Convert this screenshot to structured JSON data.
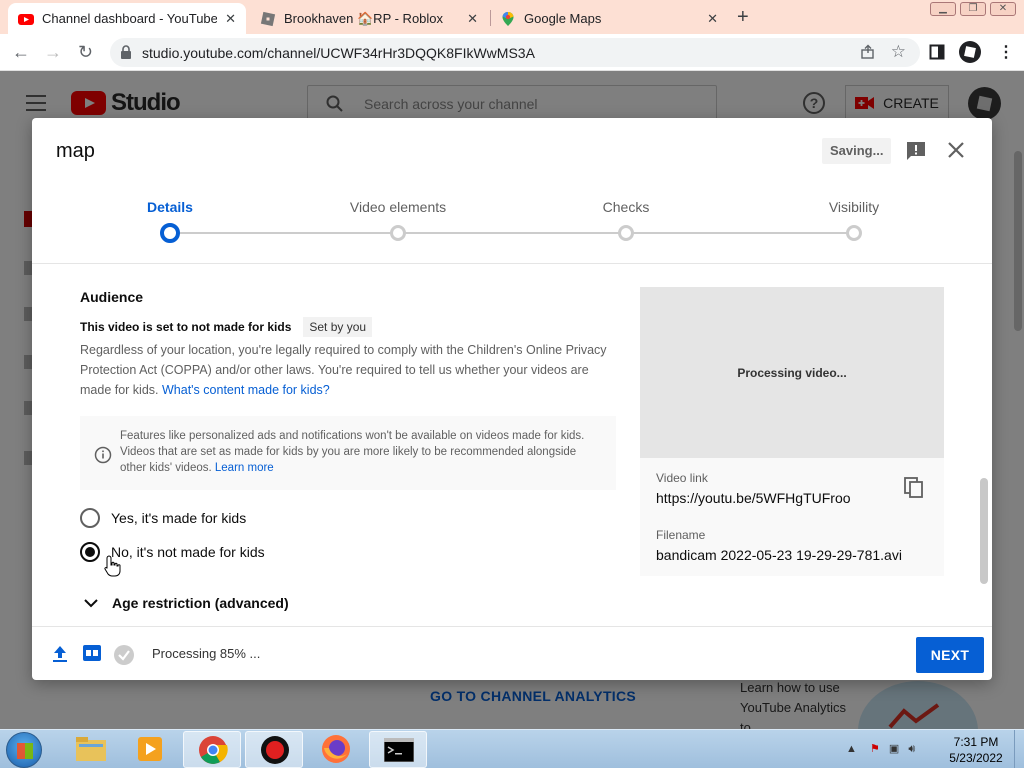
{
  "browser": {
    "tabs": [
      {
        "title": "Channel dashboard - YouTube St",
        "active": true,
        "icon": "youtube-icon"
      },
      {
        "title": "Brookhaven 🏠RP - Roblox",
        "active": false,
        "icon": "roblox-icon"
      },
      {
        "title": "Google Maps",
        "active": false,
        "icon": "maps-pin-icon"
      }
    ],
    "close_glyph": "✕",
    "new_tab_glyph": "+",
    "url": "studio.youtube.com/channel/UCWF34rHr3DQQK8FIkWwMS3A"
  },
  "studio": {
    "brand": "Studio",
    "search_placeholder": "Search across your channel",
    "create_label": "CREATE",
    "help_glyph": "?",
    "go_analytics": "GO TO CHANNEL ANALYTICS",
    "learn_card": "Learn how to use YouTube Analytics to"
  },
  "dialog": {
    "title": "map",
    "saving": "Saving...",
    "steps": [
      {
        "label": "Details",
        "active": true
      },
      {
        "label": "Video elements",
        "active": false
      },
      {
        "label": "Checks",
        "active": false
      },
      {
        "label": "Visibility",
        "active": false
      }
    ],
    "audience": {
      "heading": "Audience",
      "set_line": "This video is set to not made for kids",
      "set_chip": "Set by you",
      "body": "Regardless of your location, you're legally required to comply with the Children's Online Privacy Protection Act (COPPA) and/or other laws. You're required to tell us whether your videos are made for kids.",
      "body_link": "What's content made for kids?",
      "info": "Features like personalized ads and notifications won't be available on videos made for kids. Videos that are set as made for kids by you are more likely to be recommended alongside other kids' videos.",
      "info_link": "Learn more",
      "option_yes": "Yes, it's made for kids",
      "option_no": "No, it's not made for kids",
      "selected": "no",
      "age_restriction": "Age restriction (advanced)"
    },
    "preview": {
      "placeholder": "Processing video...",
      "video_link_label": "Video link",
      "video_link": "https://youtu.be/5WFHgTUFroo",
      "filename_label": "Filename",
      "filename": "bandicam 2022-05-23 19-29-29-781.avi"
    },
    "footer": {
      "processing": "Processing 85% ...",
      "next_label": "NEXT"
    }
  },
  "taskbar": {
    "apps": [
      "explorer",
      "media-player",
      "chrome",
      "bandicam",
      "firefox",
      "cmd"
    ],
    "time": "7:31 PM",
    "date": "5/23/2022"
  },
  "colors": {
    "accent": "#065fd4",
    "youtube_red": "#ff0000",
    "tab_bar": "#fde0d4"
  }
}
